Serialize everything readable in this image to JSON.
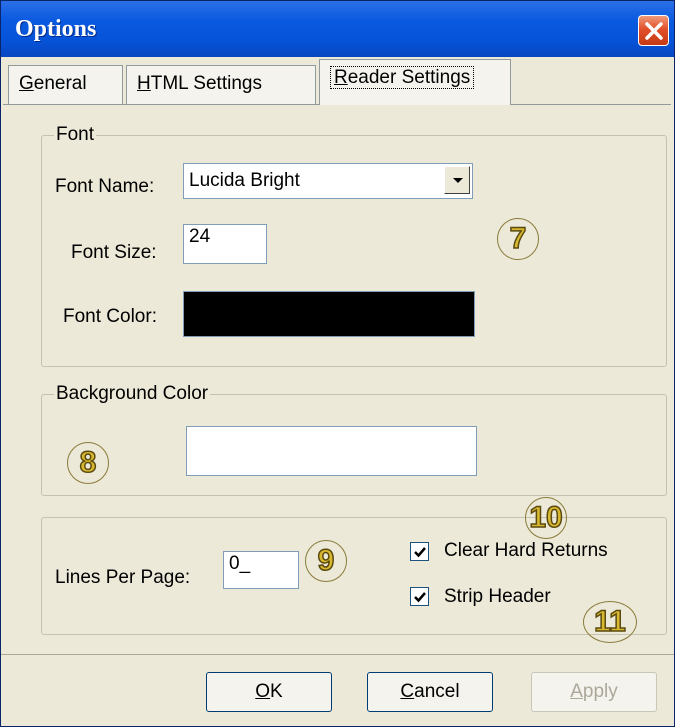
{
  "window": {
    "title": "Options"
  },
  "tabs": [
    {
      "label_prefix": "",
      "label_mnemonic": "G",
      "label_rest": "eneral"
    },
    {
      "label_prefix": "",
      "label_mnemonic": "H",
      "label_rest": "TML Settings"
    },
    {
      "label_prefix": "",
      "label_mnemonic": "R",
      "label_rest": "eader Settings",
      "active": true
    }
  ],
  "font_group": {
    "title": "Font",
    "font_name_label": "Font Name:",
    "font_name_value": "Lucida Bright",
    "font_size_label": "Font Size:",
    "font_size_value": "24",
    "font_color_label": "Font Color:",
    "font_color_value": "#000000"
  },
  "background_group": {
    "title": "Background Color",
    "color_value": "#ffffff"
  },
  "page_group": {
    "lines_per_page_label": "Lines Per Page:",
    "lines_per_page_value": "0_",
    "clear_hard_returns_label": "Clear Hard Returns",
    "clear_hard_returns_checked": true,
    "strip_header_label": "Strip Header",
    "strip_header_checked": true
  },
  "callouts": [
    "7",
    "8",
    "9",
    "10",
    "11"
  ],
  "buttons": {
    "ok_mnemonic": "O",
    "ok_rest": "K",
    "cancel_mnemonic": "C",
    "cancel_rest": "ancel",
    "apply_mnemonic": "A",
    "apply_rest": "pply"
  },
  "colors": {
    "titlebar": "#0553d8",
    "dialog_bg": "#ece9d8",
    "close": "#e2502a",
    "callout": "#d8b82e"
  }
}
